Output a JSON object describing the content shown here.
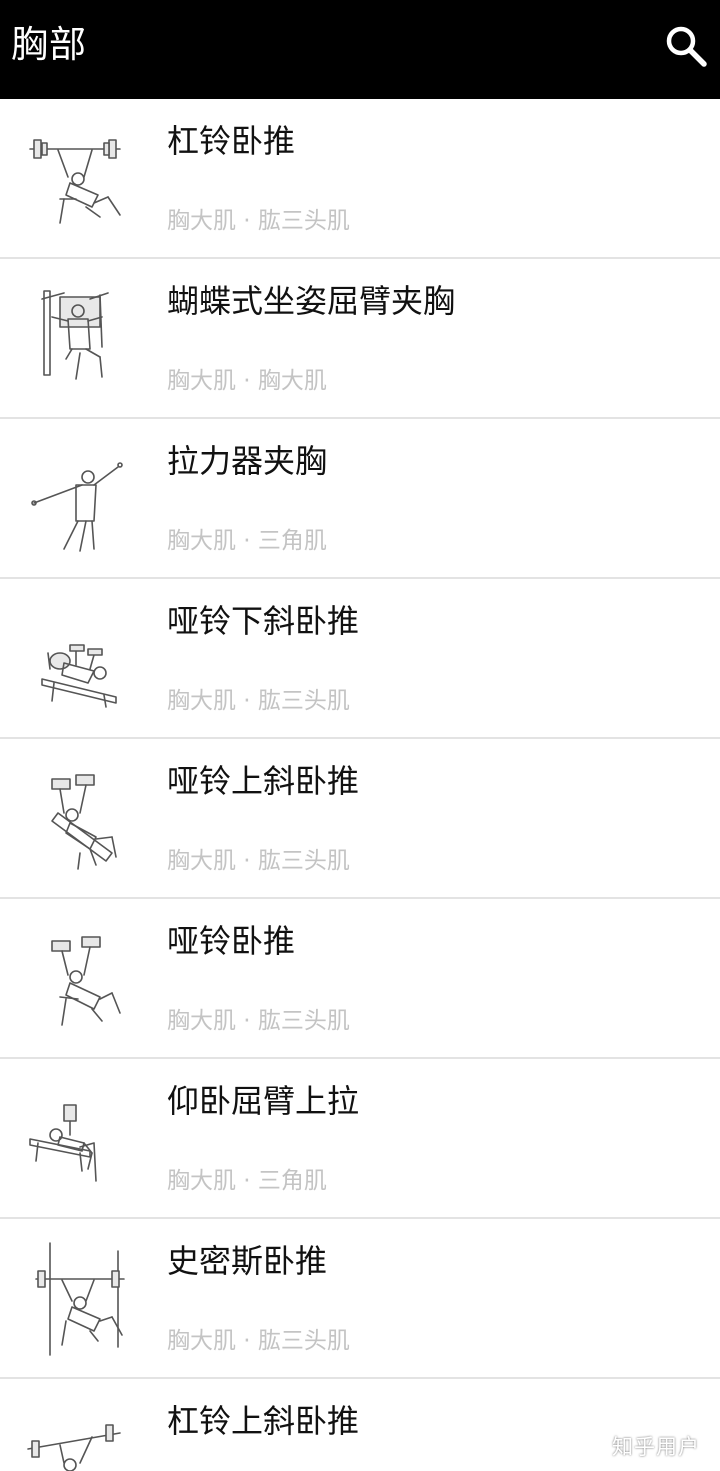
{
  "header": {
    "title": "胸部",
    "search_icon": "search-icon"
  },
  "exercises": [
    {
      "title": "杠铃卧推",
      "muscles": "胸大肌 · 肱三头肌",
      "illustration": "barbell-bench-press"
    },
    {
      "title": "蝴蝶式坐姿屈臂夹胸",
      "muscles": "胸大肌 · 胸大肌",
      "illustration": "pec-deck-machine"
    },
    {
      "title": "拉力器夹胸",
      "muscles": "胸大肌 · 三角肌",
      "illustration": "cable-crossover"
    },
    {
      "title": "哑铃下斜卧推",
      "muscles": "胸大肌 · 肱三头肌",
      "illustration": "decline-dumbbell-press"
    },
    {
      "title": "哑铃上斜卧推",
      "muscles": "胸大肌 · 肱三头肌",
      "illustration": "incline-dumbbell-press"
    },
    {
      "title": "哑铃卧推",
      "muscles": "胸大肌 · 肱三头肌",
      "illustration": "dumbbell-bench-press"
    },
    {
      "title": "仰卧屈臂上拉",
      "muscles": "胸大肌 · 三角肌",
      "illustration": "dumbbell-pullover"
    },
    {
      "title": "史密斯卧推",
      "muscles": "胸大肌 · 肱三头肌",
      "illustration": "smith-bench-press"
    },
    {
      "title": "杠铃上斜卧推",
      "muscles": "",
      "illustration": "incline-barbell-press"
    }
  ],
  "watermark": "知乎用户"
}
